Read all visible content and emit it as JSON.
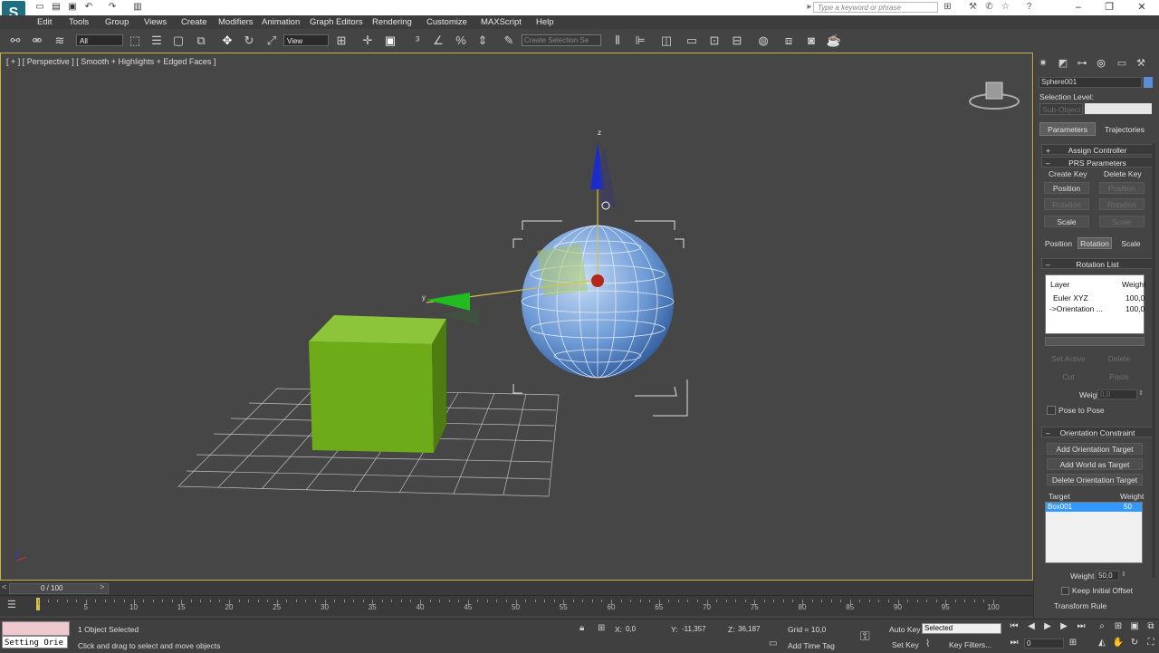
{
  "titlebar": {
    "search_placeholder": "Type a keyword or phrase",
    "logo_text": "S"
  },
  "menu": [
    "Edit",
    "Tools",
    "Group",
    "Views",
    "Create",
    "Modifiers",
    "Animation",
    "Graph Editors",
    "Rendering",
    "Customize",
    "MAXScript",
    "Help"
  ],
  "toolbar": {
    "selection_filter": "All",
    "coordinate_system": "View",
    "named_selection_placeholder": "Create Selection Se"
  },
  "viewport": {
    "label": "[ + ] [ Perspective ] [ Smooth + Highlights + Edged Faces ]",
    "gizmo_z": "z",
    "gizmo_y": "y"
  },
  "panel": {
    "object_name": "Sphere001",
    "selection_level_label": "Selection Level:",
    "sub_object": "Sub-Object",
    "tabs": [
      "Parameters",
      "Trajectories"
    ],
    "assign_controller": "Assign Controller",
    "prs_parameters": "PRS Parameters",
    "create_key": "Create Key",
    "delete_key": "Delete Key",
    "create_buttons": [
      "Position",
      "Rotation",
      "Scale"
    ],
    "delete_buttons": [
      "Position",
      "Rotation",
      "Scale"
    ],
    "prs_tabs": [
      "Position",
      "Rotation",
      "Scale"
    ],
    "rotation_list": "Rotation List",
    "list_header_layer": "Layer",
    "list_header_weight": "Weight",
    "list_rows": [
      {
        "layer": "Euler XYZ",
        "weight": "100,0"
      },
      {
        "layer": "->Orientation ...",
        "weight": "100,0"
      }
    ],
    "set_active": "Set Active",
    "delete": "Delete",
    "cut": "Cut",
    "paste": "Paste",
    "weight_label": "Weight:",
    "weight_value": "0,0",
    "pose_to_pose": "Pose to Pose",
    "orientation_constraint": "Orientation Constraint",
    "add_orientation_target": "Add Orientation Target",
    "add_world_as_target": "Add World as Target",
    "delete_orientation_target": "Delete Orientation Target",
    "target_header": "Target",
    "target_weight_header": "Weight",
    "target_row": {
      "name": "Box001",
      "weight": "50"
    },
    "target_weight_label": "Weight",
    "target_weight_value": "50,0",
    "keep_initial_offset": "Keep Initial Offset",
    "transform_rule": "Transform Rule"
  },
  "timeline": {
    "frame_label": "0 / 100",
    "ticks": [
      "5",
      "10",
      "15",
      "20",
      "25",
      "30",
      "35",
      "40",
      "45",
      "50",
      "55",
      "60",
      "65",
      "70",
      "75",
      "80",
      "85",
      "90",
      "95",
      "100"
    ]
  },
  "status": {
    "maxscript_text": "Setting Orie",
    "selected_text": "1 Object Selected",
    "prompt_text": "Click and drag to select and move objects",
    "x_label": "X:",
    "x_value": "0,0",
    "y_label": "Y:",
    "y_value": "-11,357",
    "z_label": "Z:",
    "z_value": "36,187",
    "grid": "Grid = 10,0",
    "add_time_tag": "Add Time Tag",
    "auto_key": "Auto Key",
    "set_key": "Set Key",
    "key_mode": "Selected",
    "key_filters": "Key Filters...",
    "current_frame": "0"
  },
  "colors": {
    "box": "#72b01e",
    "sphere": "#7fa7d8",
    "gizmo_z": "#1a2ccc",
    "gizmo_y": "#22bb22",
    "viewport_border": "#c9b24a",
    "selected_row": "#3399ff"
  }
}
